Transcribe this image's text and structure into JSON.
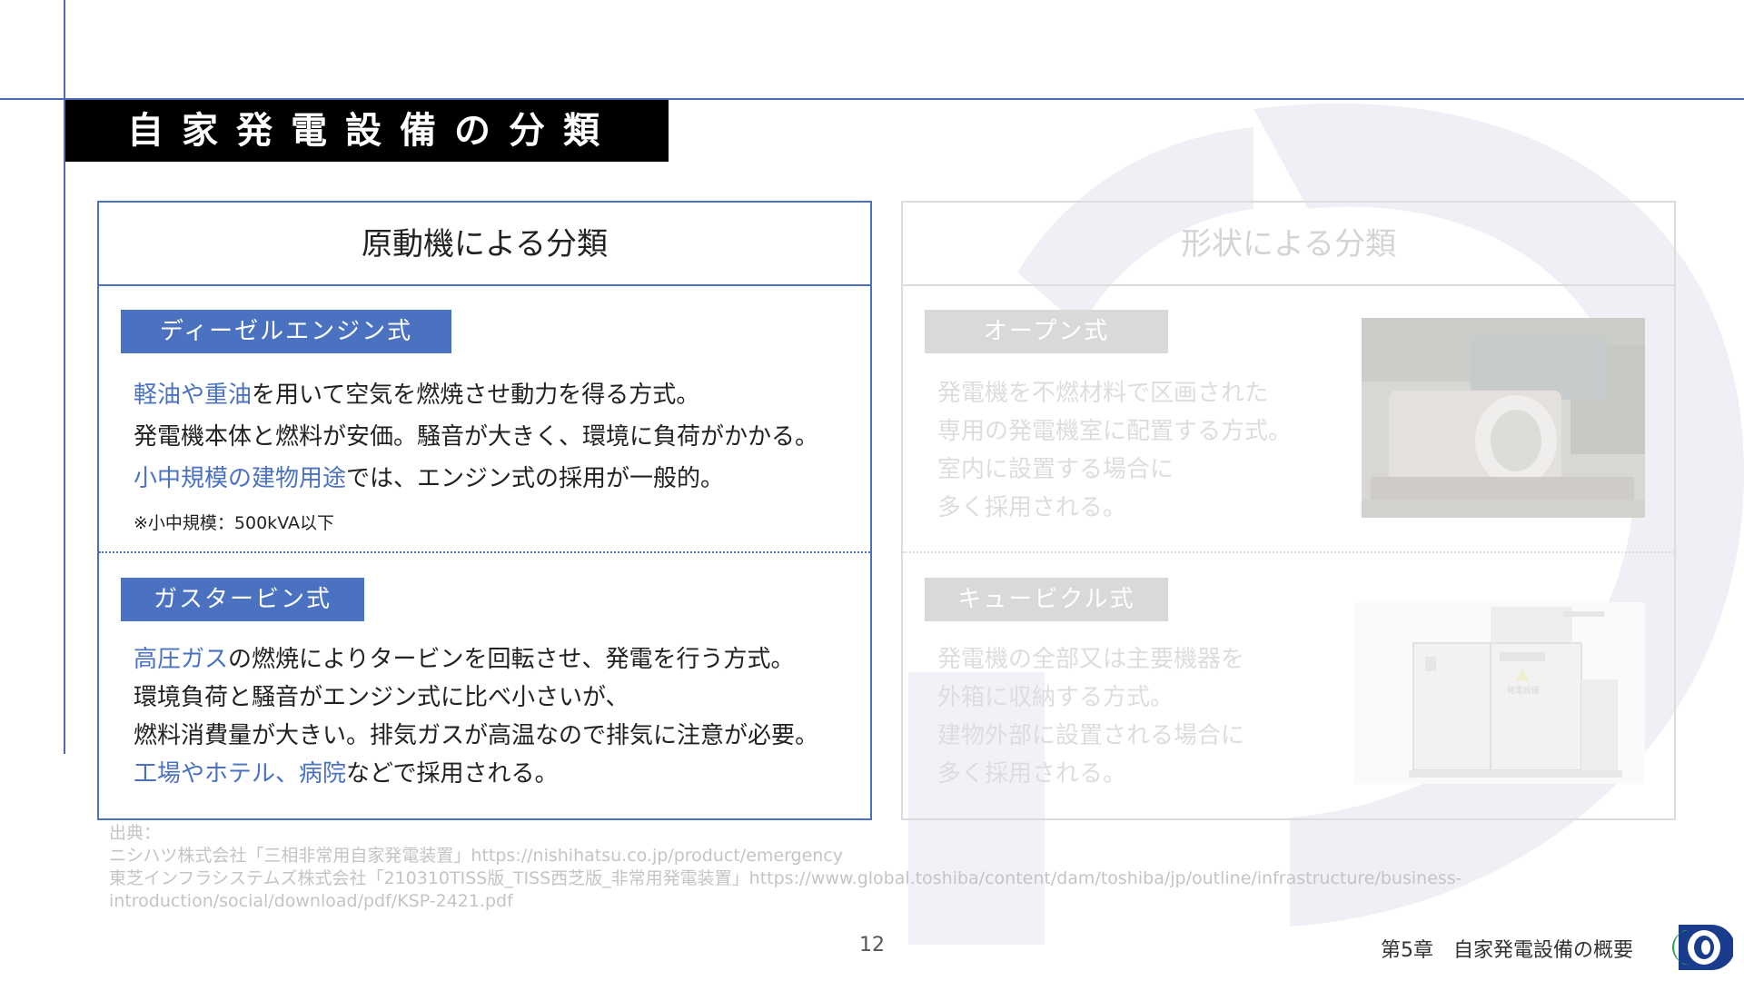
{
  "title": "自家発電設備の分類",
  "left_panel": {
    "header": "原動機による分類",
    "sections": [
      {
        "tag": "ディーゼルエンジン式",
        "lines": [
          {
            "hl": "軽油や重油",
            "rest": "を用いて空気を燃焼させ動力を得る方式。"
          },
          {
            "hl": "",
            "rest": "発電機本体と燃料が安価。騒音が大きく、環境に負荷がかかる。"
          },
          {
            "hl": "小中規模の建物用途",
            "rest": "では、エンジン式の採用が一般的。"
          }
        ],
        "note": "※小中規模：500kVA以下"
      },
      {
        "tag": "ガスタービン式",
        "lines": [
          {
            "hl": "高圧ガス",
            "rest": "の燃焼によりタービンを回転させ、発電を行う方式。"
          },
          {
            "hl": "",
            "rest": "環境負荷と騒音がエンジン式に比べ小さいが、"
          },
          {
            "hl": "",
            "rest": "燃料消費量が大きい。排気ガスが高温なので排気に注意が必要。"
          },
          {
            "hl": "工場やホテル、病院",
            "rest": "などで採用される。"
          }
        ]
      }
    ]
  },
  "right_panel": {
    "header": "形状による分類",
    "sections": [
      {
        "tag": "オープン式",
        "lines": [
          "発電機を不燃材料で区画された",
          "専用の発電機室に配置する方式。",
          "室内に設置する場合に",
          "多く採用される。"
        ]
      },
      {
        "tag": "キュービクル式",
        "lines": [
          "発電機の全部又は主要機器を",
          "外箱に収納する方式。",
          "建物外部に設置される場合に",
          "多く採用される。"
        ]
      }
    ],
    "cubicle_label": "発電設備"
  },
  "sources": [
    "出典：",
    "ニシハツ株式会社「三相非常用自家発電装置」https://nishihatsu.co.jp/product/emergency",
    "東芝インフラシステムズ株式会社「210310TISS版_TISS西芝版_非常用発電装置」https://www.global.toshiba/content/dam/toshiba/jp/outline/infrastructure/business-",
    "introduction/social/download/pdf/KSP-2421.pdf"
  ],
  "footer": {
    "page_number": "12",
    "chapter": "第5章　自家発電設備の概要"
  },
  "colors": {
    "accent_blue": "#4a72c0",
    "title_bar": "#000000",
    "faded_gray": "#dddddd"
  }
}
